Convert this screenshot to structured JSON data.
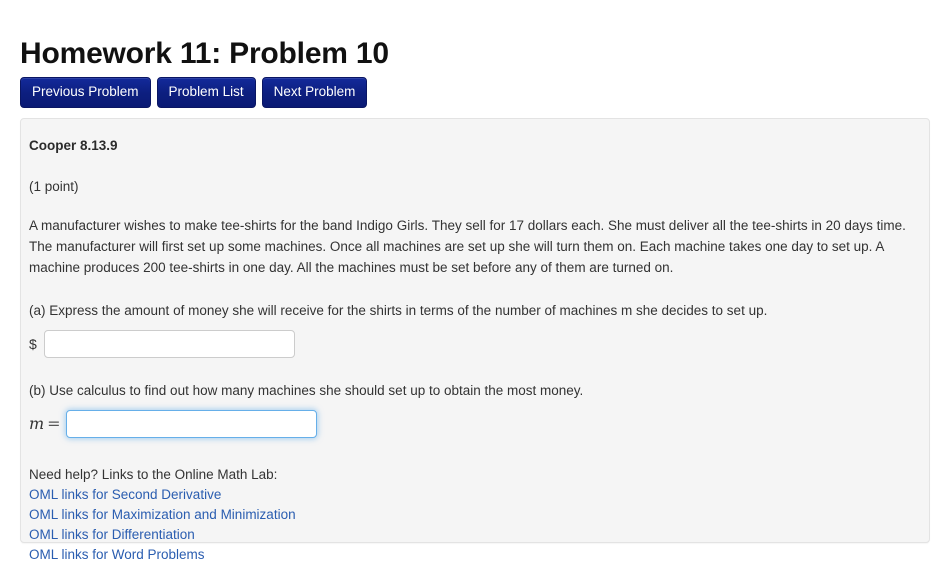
{
  "header": {
    "title": "Homework 11: Problem 10"
  },
  "nav": {
    "buttons": [
      {
        "label": "Previous Problem",
        "name": "previous-problem-button"
      },
      {
        "label": "Problem List",
        "name": "problem-list-button"
      },
      {
        "label": "Next Problem",
        "name": "next-problem-button"
      }
    ]
  },
  "problem": {
    "source": "Cooper 8.13.9",
    "points": "(1 point)",
    "statement": "A manufacturer wishes to make tee-shirts for the band Indigo Girls. They sell for 17 dollars each. She must deliver all the tee-shirts in 20 days time. The manufacturer will first set up some machines. Once all machines are set up she will turn them on. Each machine takes one day to set up. A machine produces 200 tee-shirts in one day. All the machines must be set before any of them are turned on.",
    "parts": [
      {
        "prompt": "(a) Express the amount of money she will receive for the shirts in terms of the number of machines m she decides to set up.",
        "label": "$",
        "value": "",
        "focused": false
      },
      {
        "prompt": "(b) Use calculus to find out how many machines she should set up to obtain the most money.",
        "label": "m",
        "label_operator": "=",
        "value": "",
        "focused": true
      }
    ]
  },
  "help": {
    "heading": "Need help? Links to the Online Math Lab:",
    "links": [
      "OML links for Second Derivative",
      "OML links for Maximization and Minimization",
      "OML links for Differentiation",
      "OML links for Word Problems"
    ]
  },
  "colors": {
    "button_navy": "#0d1f80",
    "link_blue": "#2a5db0",
    "panel_background": "#f5f5f5",
    "panel_border": "#e3e3e3",
    "focus_blue": "#66afe9"
  }
}
